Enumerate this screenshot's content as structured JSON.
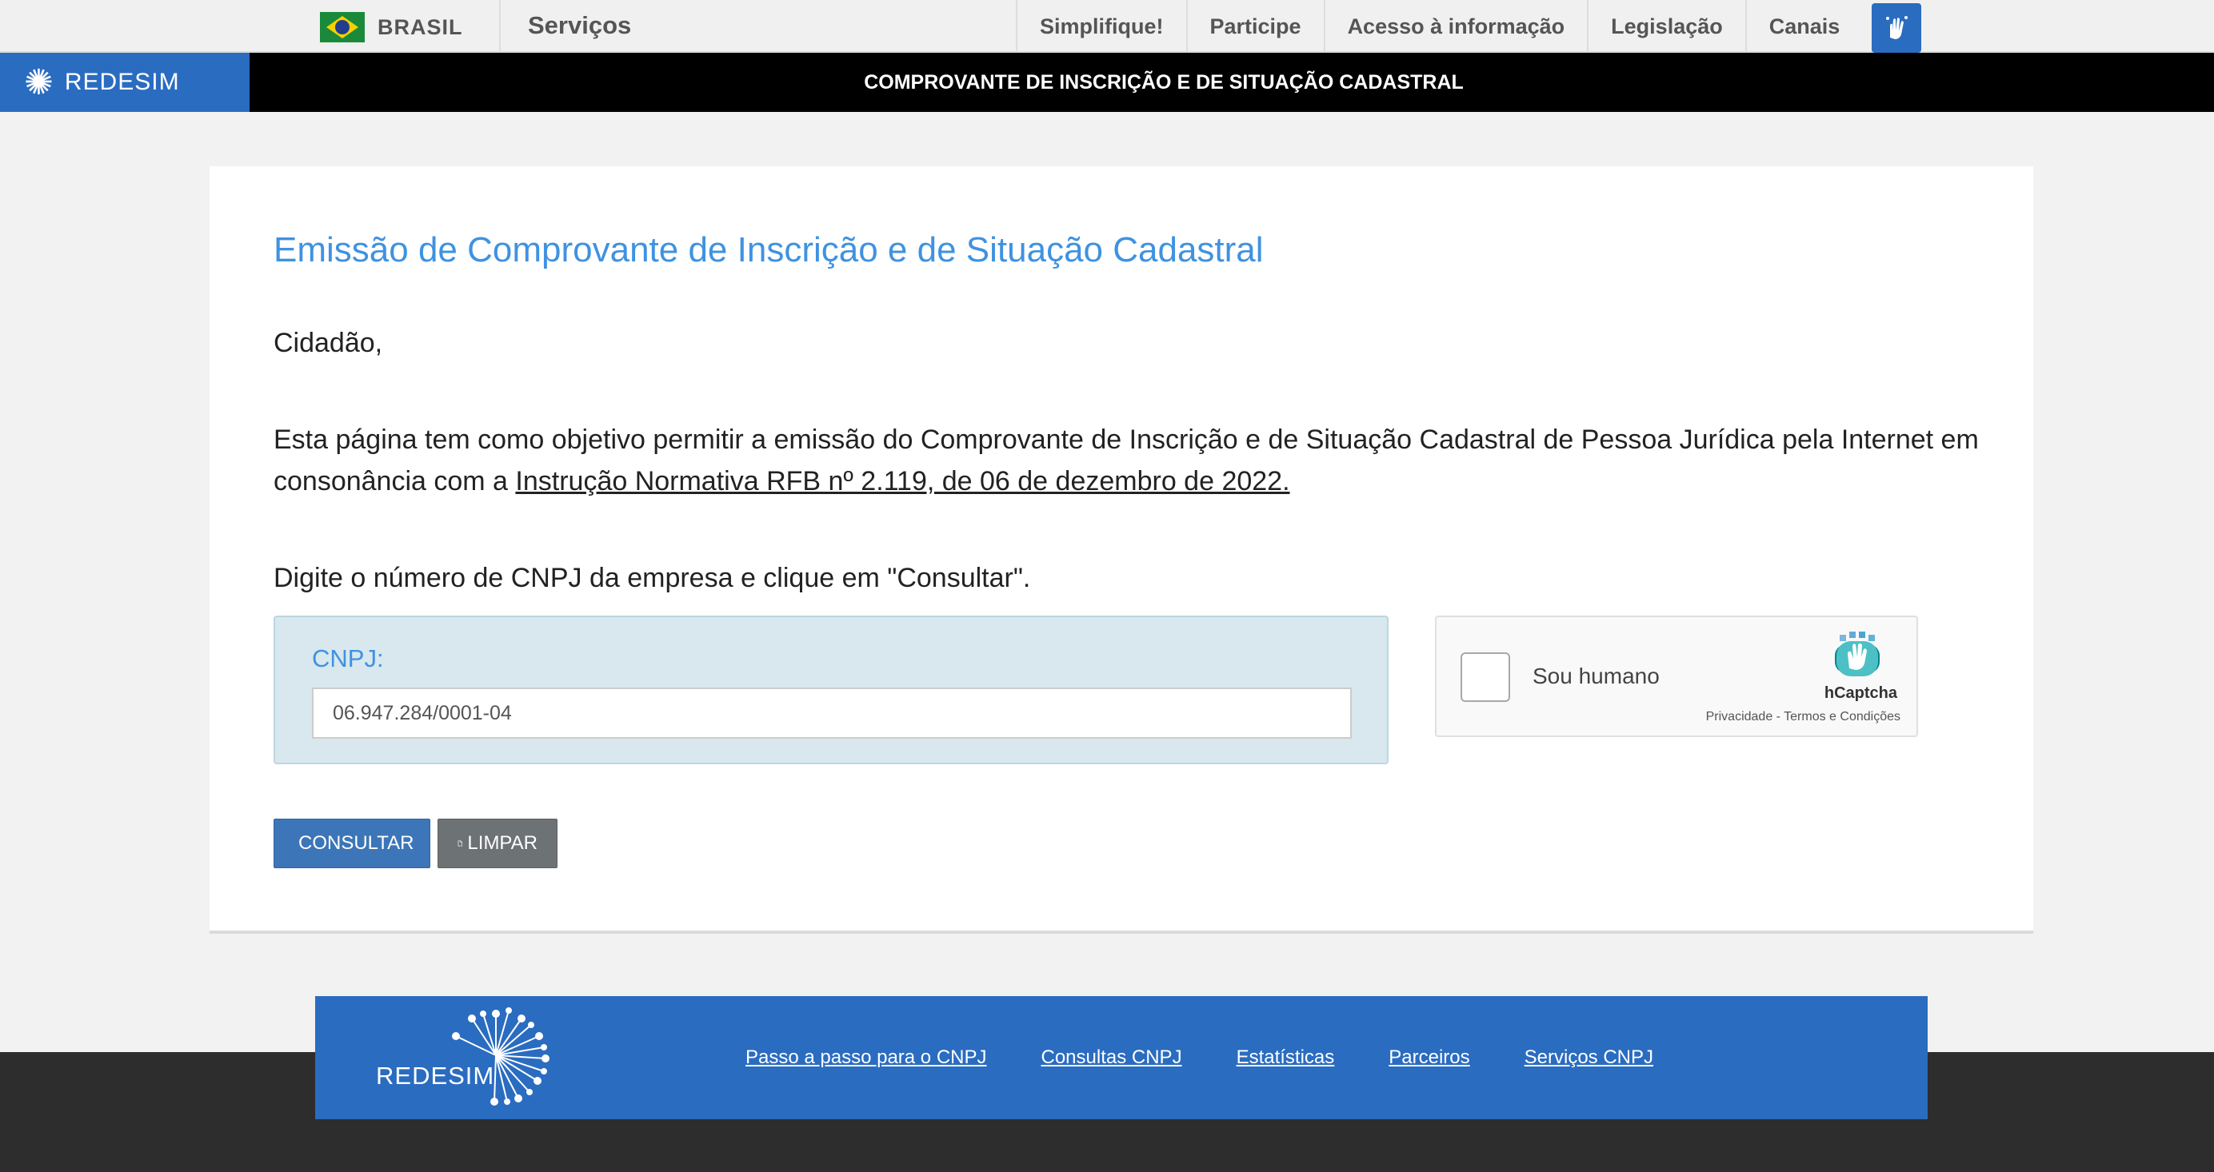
{
  "govbar": {
    "country": "BRASIL",
    "services": "Serviços",
    "links": [
      "Simplifique!",
      "Participe",
      "Acesso à informação",
      "Legislação",
      "Canais"
    ],
    "accessibility_icon": "hand-sign-icon"
  },
  "redesim": {
    "logo_text": "REDESIM",
    "banner_title": "COMPROVANTE DE INSCRIÇÃO E DE SITUAÇÃO CADASTRAL"
  },
  "main": {
    "title": "Emissão de Comprovante de Inscrição e de Situação Cadastral",
    "greeting": "Cidadão,",
    "intro_text": "Esta página tem como objetivo permitir a emissão do Comprovante de Inscrição e de Situação Cadastral de Pessoa Jurídica pela Internet em consonância com a ",
    "intro_link": "Instrução Normativa RFB nº 2.119, de 06 de dezembro de 2022.",
    "instruction": "Digite o número de CNPJ da empresa e clique em \"Consultar\".",
    "cnpj_label": "CNPJ:",
    "cnpj_value": "06.947.284/0001-04"
  },
  "captcha": {
    "label": "Sou humano",
    "brand": "hCaptcha",
    "terms": "Privacidade - Termos e Condições"
  },
  "buttons": {
    "consultar": "CONSULTAR",
    "limpar": "LIMPAR"
  },
  "footer": {
    "logo_text": "REDESIM",
    "links": [
      "Passo a passo para o CNPJ",
      "Consultas CNPJ",
      "Estatísticas",
      "Parceiros",
      "Serviços CNPJ"
    ]
  },
  "colors": {
    "accent_blue": "#3f92e0",
    "brand_blue": "#2a6cc0",
    "button_blue": "#3c76b8",
    "button_gray": "#6d7275"
  }
}
